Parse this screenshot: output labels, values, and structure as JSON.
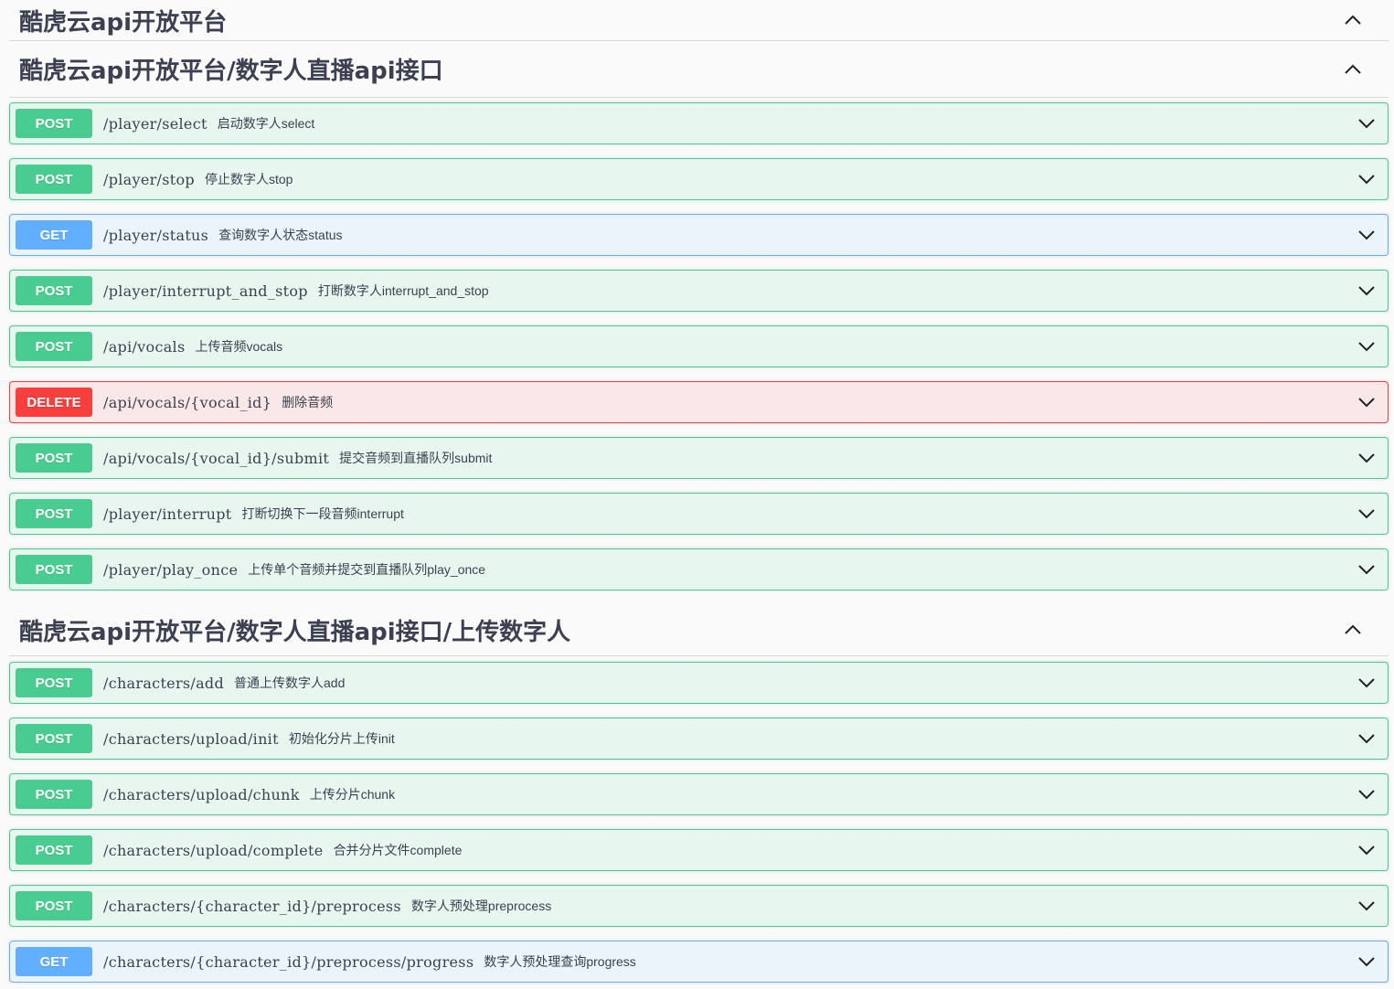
{
  "groups": [
    {
      "title": "酷虎云api开放平台",
      "expanded": true,
      "operations": []
    },
    {
      "title": "酷虎云api开放平台/数字人直播api接口",
      "expanded": true,
      "operations": [
        {
          "method": "POST",
          "path": "/player/select",
          "summary": "启动数字人select"
        },
        {
          "method": "POST",
          "path": "/player/stop",
          "summary": "停止数字人stop"
        },
        {
          "method": "GET",
          "path": "/player/status",
          "summary": "查询数字人状态status"
        },
        {
          "method": "POST",
          "path": "/player/interrupt_and_stop",
          "summary": "打断数字人interrupt_and_stop"
        },
        {
          "method": "POST",
          "path": "/api/vocals",
          "summary": "上传音频vocals"
        },
        {
          "method": "DELETE",
          "path": "/api/vocals/{vocal_id}",
          "summary": "删除音频"
        },
        {
          "method": "POST",
          "path": "/api/vocals/{vocal_id}/submit",
          "summary": "提交音频到直播队列submit"
        },
        {
          "method": "POST",
          "path": "/player/interrupt",
          "summary": "打断切换下一段音频interrupt"
        },
        {
          "method": "POST",
          "path": "/player/play_once",
          "summary": "上传单个音频并提交到直播队列play_once"
        }
      ]
    },
    {
      "title": "酷虎云api开放平台/数字人直播api接口/上传数字人",
      "expanded": true,
      "operations": [
        {
          "method": "POST",
          "path": "/characters/add",
          "summary": "普通上传数字人add"
        },
        {
          "method": "POST",
          "path": "/characters/upload/init",
          "summary": "初始化分片上传init"
        },
        {
          "method": "POST",
          "path": "/characters/upload/chunk",
          "summary": "上传分片chunk"
        },
        {
          "method": "POST",
          "path": "/characters/upload/complete",
          "summary": "合并分片文件complete"
        },
        {
          "method": "POST",
          "path": "/characters/{character_id}/preprocess",
          "summary": "数字人预处理preprocess"
        },
        {
          "method": "GET",
          "path": "/characters/{character_id}/preprocess/progress",
          "summary": "数字人预处理查询progress"
        }
      ]
    }
  ],
  "colors": {
    "post": "#49cc90",
    "get": "#61affe",
    "delete": "#f93e3e"
  },
  "icons": {
    "group_toggle": "chevron-up-icon",
    "operation_toggle": "chevron-down-icon"
  }
}
